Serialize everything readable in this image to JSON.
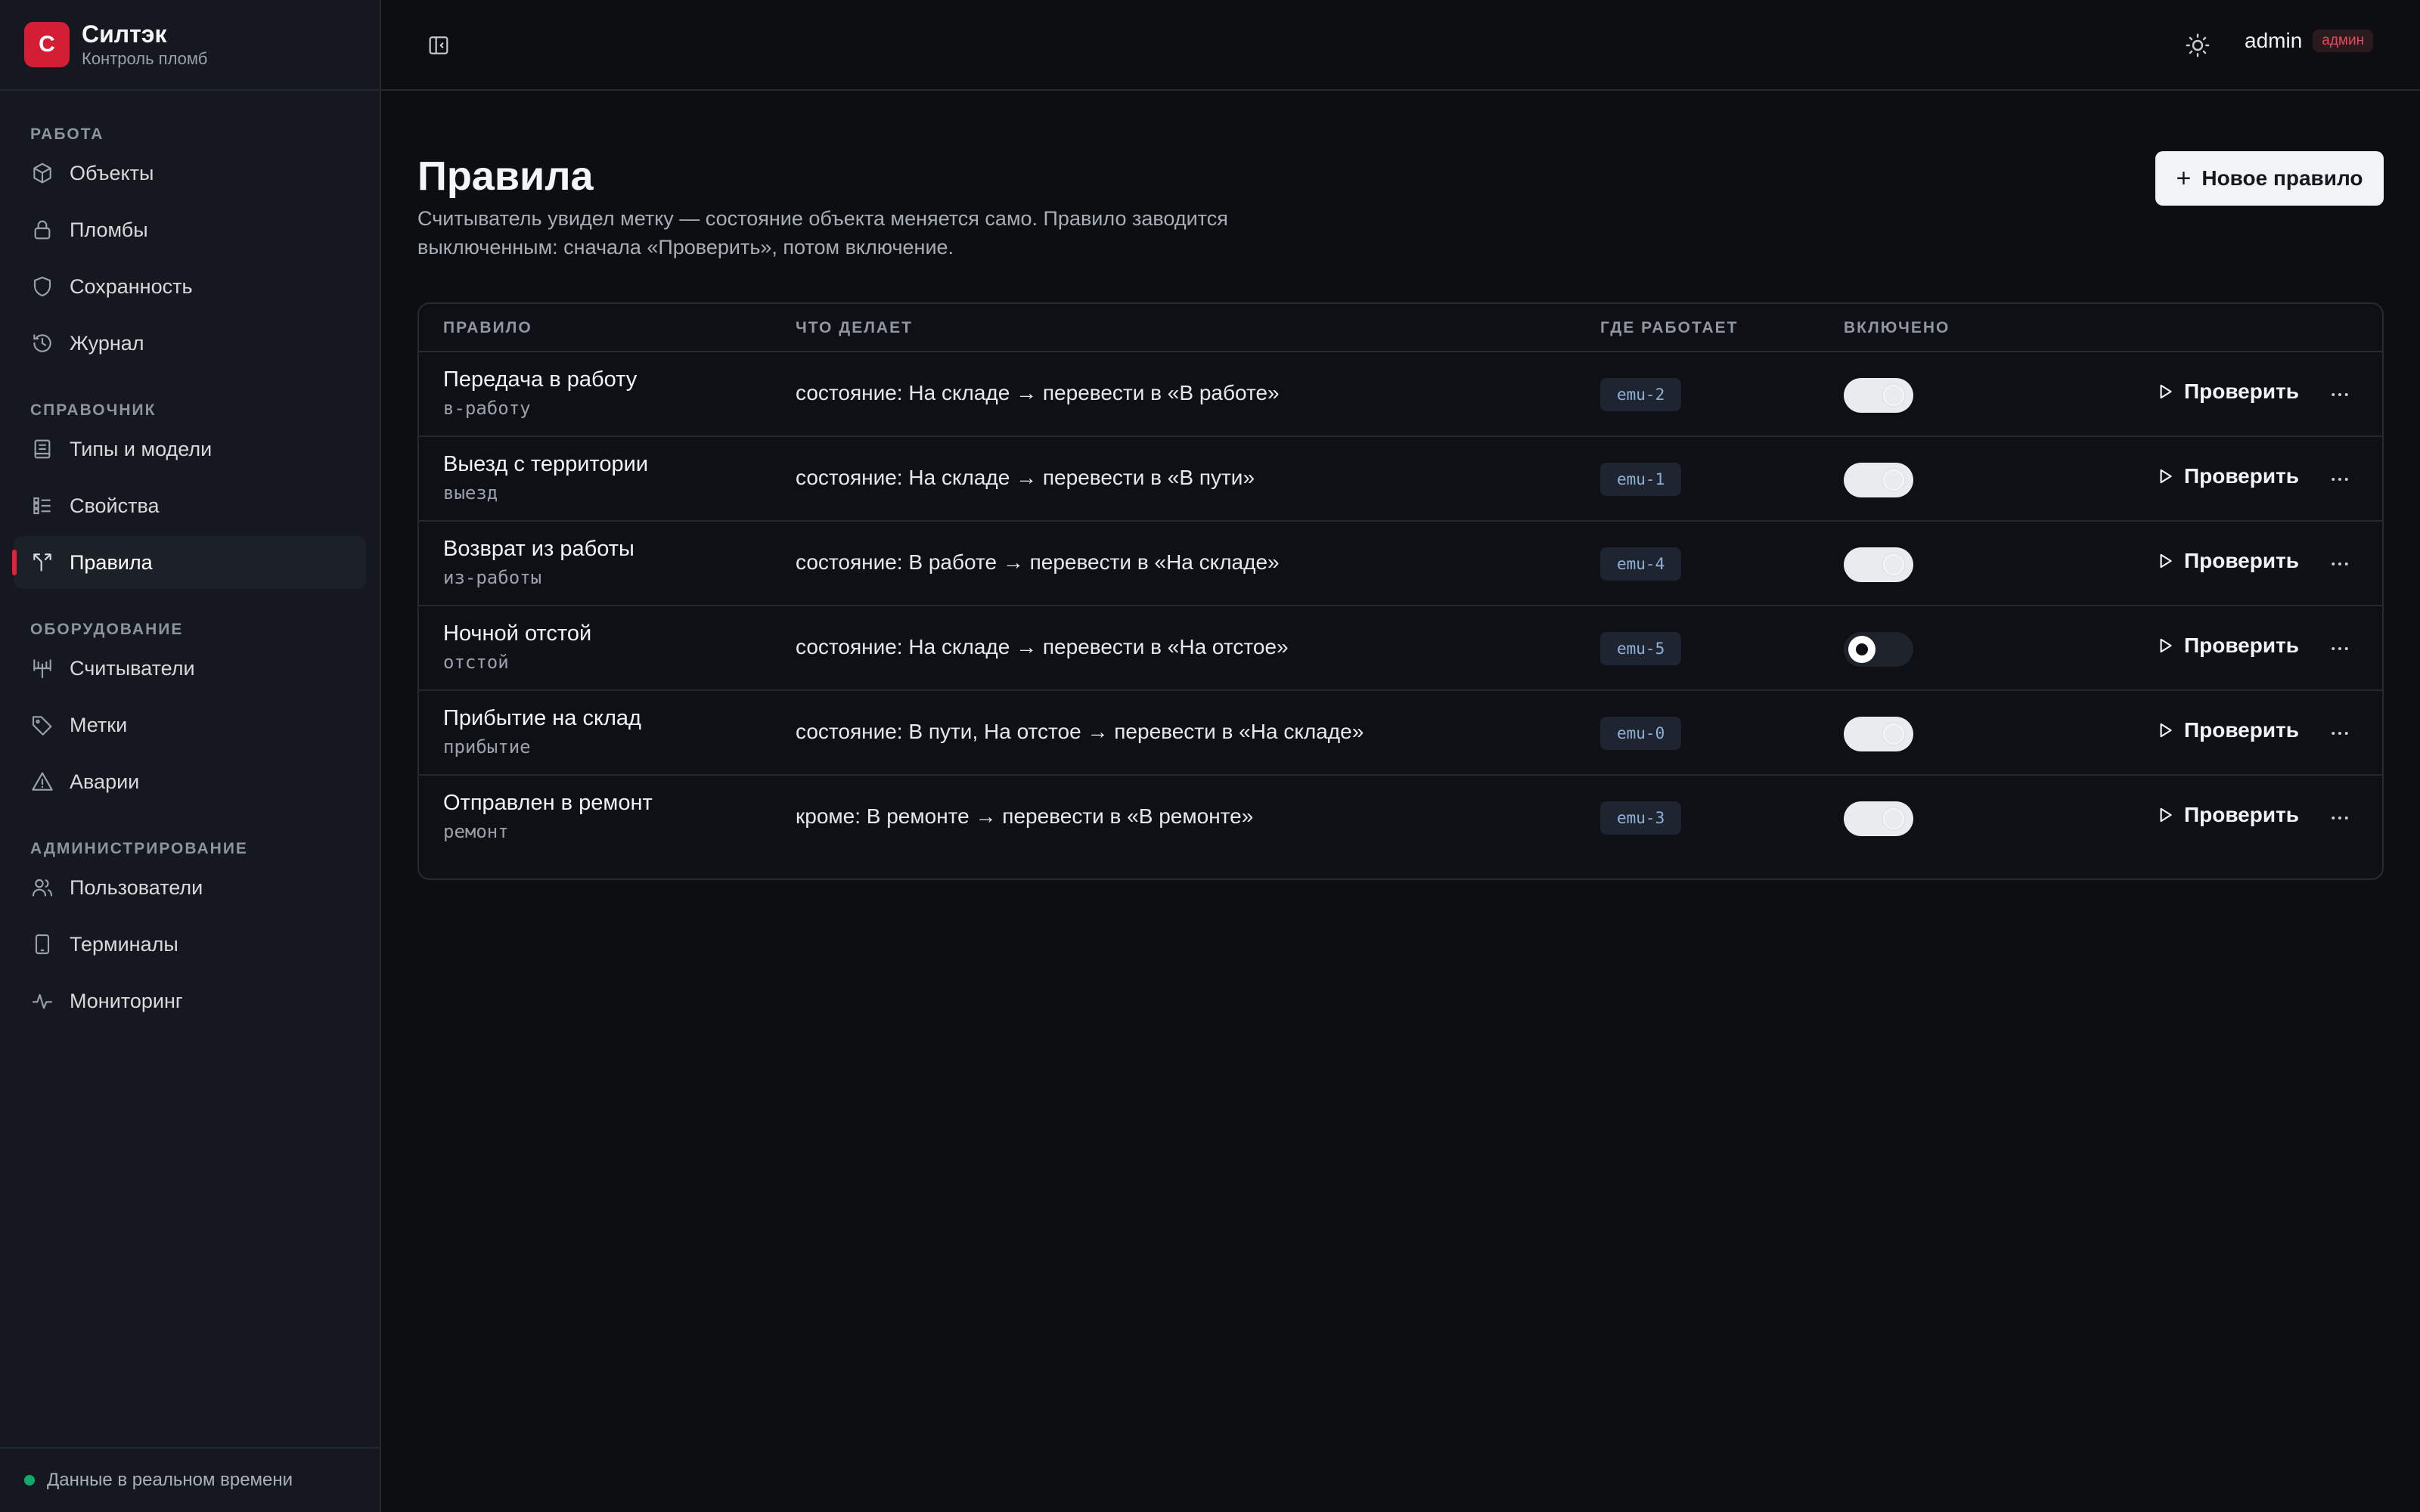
{
  "brand": {
    "logo_letter": "С",
    "name": "Силтэк",
    "subtitle": "Контроль пломб"
  },
  "sidebar": {
    "sections": [
      {
        "title": "РАБОТА",
        "items": [
          {
            "label": "Объекты",
            "icon": "cube-icon"
          },
          {
            "label": "Пломбы",
            "icon": "lock-icon"
          },
          {
            "label": "Сохранность",
            "icon": "shield-icon"
          },
          {
            "label": "Журнал",
            "icon": "history-icon"
          }
        ]
      },
      {
        "title": "СПРАВОЧНИК",
        "items": [
          {
            "label": "Типы и модели",
            "icon": "book-icon"
          },
          {
            "label": "Свойства",
            "icon": "list-icon"
          },
          {
            "label": "Правила",
            "icon": "split-arrow-icon",
            "active": true
          }
        ]
      },
      {
        "title": "ОБОРУДОВАНИЕ",
        "items": [
          {
            "label": "Считыватели",
            "icon": "antenna-icon"
          },
          {
            "label": "Метки",
            "icon": "tag-icon"
          },
          {
            "label": "Аварии",
            "icon": "warning-icon"
          }
        ]
      },
      {
        "title": "АДМИНИСТРИРОВАНИЕ",
        "items": [
          {
            "label": "Пользователи",
            "icon": "users-icon"
          },
          {
            "label": "Терминалы",
            "icon": "tablet-icon"
          },
          {
            "label": "Мониторинг",
            "icon": "pulse-icon"
          }
        ]
      }
    ],
    "footer_status": "Данные в реальном времени"
  },
  "topbar": {
    "user_name": "admin",
    "role_badge": "админ"
  },
  "page": {
    "title": "Правила",
    "description": "Считыватель увидел метку — состояние объекта меняется само. Правило заводится выключенным: сначала «Проверить», потом включение.",
    "new_rule_label": "Новое правило"
  },
  "table": {
    "headers": {
      "rule": "ПРАВИЛО",
      "what": "ЧТО ДЕЛАЕТ",
      "where": "ГДЕ РАБОТАЕТ",
      "enabled": "ВКЛЮЧЕНО"
    },
    "check_label": "Проверить",
    "rows": [
      {
        "name": "Передача в работу",
        "slug": "в-работу",
        "what": "состояние: На складе → перевести в «В работе»",
        "where": "emu-2",
        "enabled": true
      },
      {
        "name": "Выезд с территории",
        "slug": "выезд",
        "what": "состояние: На складе → перевести в «В пути»",
        "where": "emu-1",
        "enabled": true
      },
      {
        "name": "Возврат из работы",
        "slug": "из-работы",
        "what": "состояние: В работе → перевести в «На складе»",
        "where": "emu-4",
        "enabled": true
      },
      {
        "name": "Ночной отстой",
        "slug": "отстой",
        "what": "состояние: На складе → перевести в «На отстое»",
        "where": "emu-5",
        "enabled": false
      },
      {
        "name": "Прибытие на склад",
        "slug": "прибытие",
        "what": "состояние: В пути, На отстое → перевести в «На складе»",
        "where": "emu-0",
        "enabled": true
      },
      {
        "name": "Отправлен в ремонт",
        "slug": "ремонт",
        "what": "кроме: В ремонте → перевести в «В ремонте»",
        "where": "emu-3",
        "enabled": true
      }
    ]
  },
  "colors": {
    "accent": "#d41e35",
    "background": "#0c0e12",
    "sidebar": "#15181e",
    "live": "#14a86b"
  }
}
